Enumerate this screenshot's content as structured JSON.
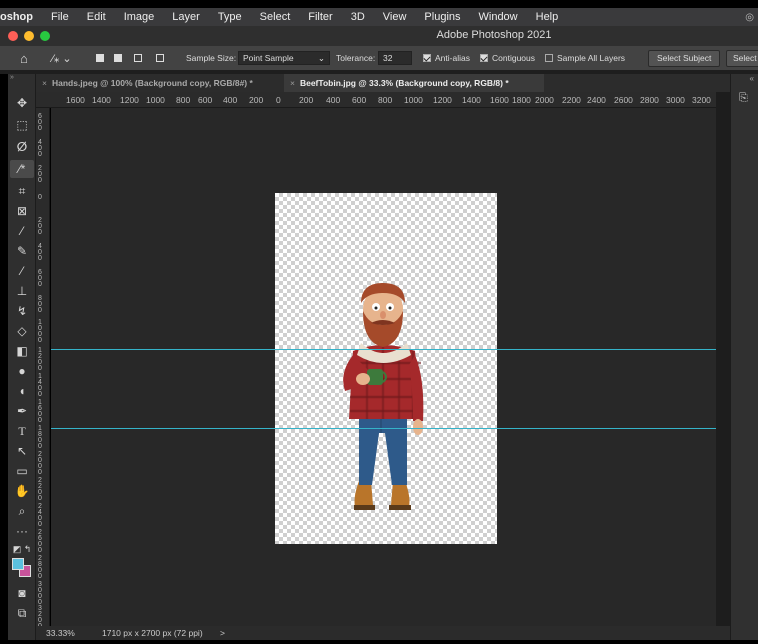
{
  "menubar": {
    "items": [
      "oshop",
      "File",
      "Edit",
      "Image",
      "Layer",
      "Type",
      "Select",
      "Filter",
      "3D",
      "View",
      "Plugins",
      "Window",
      "Help"
    ],
    "right_icon": "control-center-icon"
  },
  "titlebar": {
    "title": "Adobe Photoshop 2021"
  },
  "options": {
    "sample_size_label": "Sample Size:",
    "sample_size_value": "Point Sample",
    "tolerance_label": "Tolerance:",
    "tolerance_value": "32",
    "anti_alias": {
      "label": "Anti-alias",
      "checked": true
    },
    "contiguous": {
      "label": "Contiguous",
      "checked": true
    },
    "sample_all_layers": {
      "label": "Sample All Layers",
      "checked": false
    },
    "select_subject_label": "Select Subject",
    "select_label": "Select"
  },
  "tabs": [
    {
      "label": "Hands.jpeg @ 100% (Background copy, RGB/8#) *",
      "active": false
    },
    {
      "label": "BeefTobin.jpg @ 33.3% (Background copy, RGB/8) *",
      "active": true
    }
  ],
  "hruler": {
    "labels": [
      "1600",
      "1400",
      "1200",
      "1000",
      "800",
      "600",
      "400",
      "200",
      "0",
      "200",
      "400",
      "600",
      "800",
      "1000",
      "1200",
      "1400",
      "1600",
      "1800",
      "2000",
      "2200",
      "2400",
      "2600",
      "2800",
      "3000",
      "3200"
    ]
  },
  "vruler": {
    "labels": [
      "600",
      "400",
      "200",
      "0",
      "200",
      "400",
      "600",
      "800",
      "1000",
      "1200",
      "1400",
      "1600",
      "1800",
      "2000",
      "2200",
      "2400",
      "2600",
      "2800",
      "3000",
      "3200"
    ]
  },
  "tools": [
    "move-tool-icon",
    "marquee-tool-icon",
    "lasso-tool-icon",
    "magic-wand-tool-icon",
    "crop-tool-icon",
    "frame-tool-icon",
    "eyedropper-tool-icon",
    "healing-brush-icon",
    "brush-tool-icon",
    "clone-stamp-icon",
    "history-brush-icon",
    "eraser-tool-icon",
    "gradient-tool-icon",
    "blur-tool-icon",
    "dodge-tool-icon",
    "pen-tool-icon",
    "type-tool-icon",
    "path-selection-icon",
    "rectangle-tool-icon",
    "hand-tool-icon",
    "zoom-tool-icon",
    "more-tools-icon",
    "swap-colors-icon",
    "color-swatches-icon",
    "quick-mask-icon",
    "screen-mode-icon"
  ],
  "colors": {
    "foreground": "#5bc0de",
    "background": "#c8539b",
    "guide": "#35b3c9"
  },
  "status": {
    "zoom": "33.33%",
    "doc_info": "1710 px x 2700 px (72 ppi)",
    "arrow": ">"
  }
}
